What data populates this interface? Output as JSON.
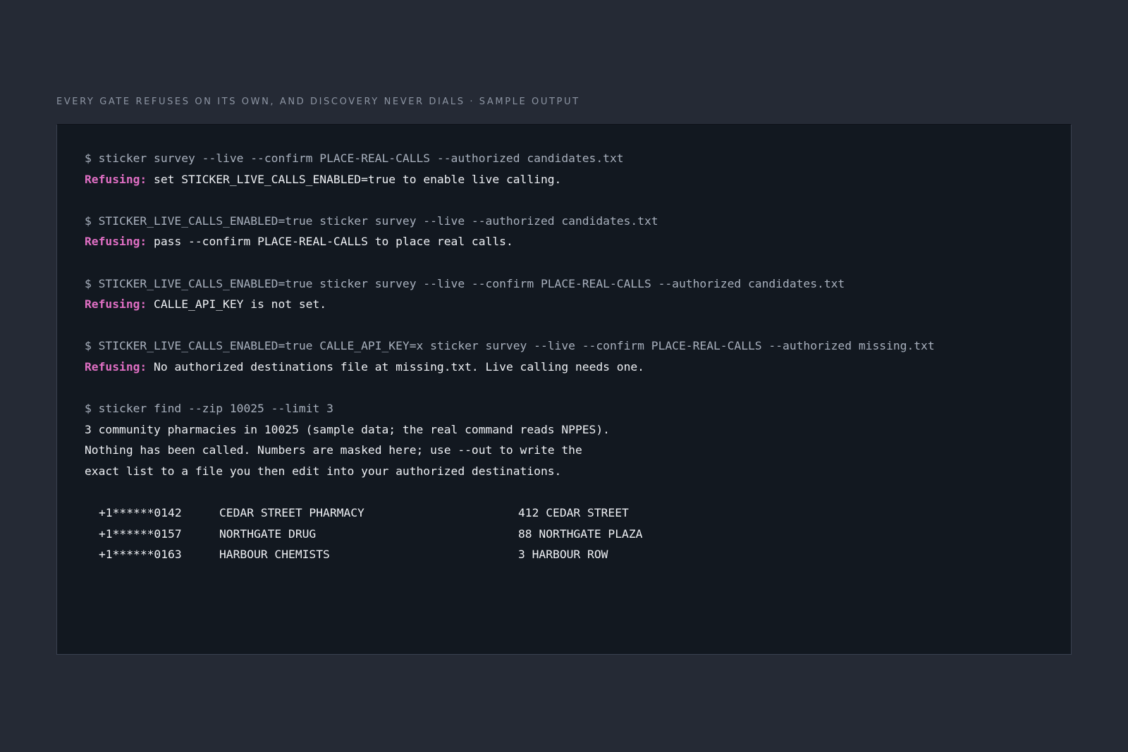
{
  "caption": "EVERY GATE REFUSES ON ITS OWN, AND DISCOVERY NEVER DIALS · SAMPLE OUTPUT",
  "terminal": {
    "attempts": [
      {
        "command": "$ sticker survey --live --confirm PLACE-REAL-CALLS --authorized candidates.txt",
        "label": "Refusing:",
        "message": " set STICKER_LIVE_CALLS_ENABLED=true to enable live calling."
      },
      {
        "command": "$ STICKER_LIVE_CALLS_ENABLED=true sticker survey --live --authorized candidates.txt",
        "label": "Refusing:",
        "message": " pass --confirm PLACE-REAL-CALLS to place real calls."
      },
      {
        "command": "$ STICKER_LIVE_CALLS_ENABLED=true sticker survey --live --confirm PLACE-REAL-CALLS --authorized candidates.txt",
        "label": "Refusing:",
        "message": " CALLE_API_KEY is not set."
      },
      {
        "command": "$ STICKER_LIVE_CALLS_ENABLED=true CALLE_API_KEY=x sticker survey --live --confirm PLACE-REAL-CALLS --authorized missing.txt",
        "label": "Refusing:",
        "message": " No authorized destinations file at missing.txt. Live calling needs one."
      }
    ],
    "find": {
      "command": "$ sticker find --zip 10025 --limit 3",
      "output": [
        "3 community pharmacies in 10025 (sample data; the real command reads NPPES).",
        "Nothing has been called. Numbers are masked here; use --out to write the",
        "exact list to a file you then edit into your authorized destinations."
      ],
      "results": [
        {
          "phone": "+1******0142",
          "name": "CEDAR STREET PHARMACY",
          "address": "412 CEDAR STREET"
        },
        {
          "phone": "+1******0157",
          "name": "NORTHGATE DRUG",
          "address": "88 NORTHGATE PLAZA"
        },
        {
          "phone": "+1******0163",
          "name": "HARBOUR CHEMISTS",
          "address": "3 HARBOUR ROW"
        }
      ]
    }
  },
  "colors": {
    "background": "#252a35",
    "terminal_background": "#121820",
    "command_text": "#a8b0bd",
    "refusing_label": "#e06fc4",
    "output_text": "#eef0f4",
    "caption_text": "#8d95a3"
  }
}
